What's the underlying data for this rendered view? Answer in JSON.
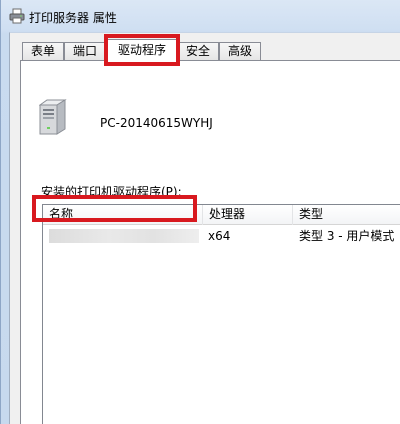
{
  "window": {
    "title": "打印服务器 属性",
    "title_icon": "printer-icon"
  },
  "tabs": [
    {
      "label": "表单",
      "active": false
    },
    {
      "label": "端口",
      "active": false
    },
    {
      "label": "驱动程序",
      "active": true
    },
    {
      "label": "安全",
      "active": false
    },
    {
      "label": "高级",
      "active": false
    }
  ],
  "panel": {
    "computer_icon": "computer-tower-icon",
    "computer_name": "PC-20140615WYHJ",
    "drivers_label": "安装的打印机驱动程序(P):",
    "columns": [
      "名称",
      "处理器",
      "类型"
    ],
    "rows": [
      {
        "name": "",
        "processor": "x64",
        "type": "类型 3 - 用户模式"
      }
    ]
  },
  "annotations": {
    "color": "#d8191f"
  }
}
